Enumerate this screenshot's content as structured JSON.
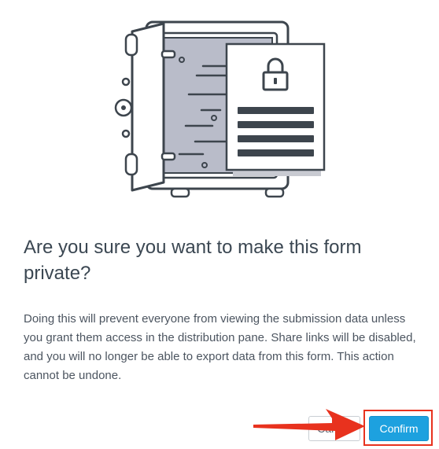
{
  "dialog": {
    "title": "Are you sure you want to make this form private?",
    "message": "Doing this will prevent everyone from viewing the submission data unless you grant them access in the distribution pane. Share links will be disabled, and you will no longer be able to export data from this form. This action cannot be undone.",
    "cancel_label": "Cancel",
    "confirm_label": "Confirm"
  },
  "illustration": {
    "name": "vault-with-locked-document",
    "icon": "lock-icon"
  },
  "annotations": {
    "arrow": "red-pointer-arrow",
    "highlight": "red-highlight-box"
  },
  "colors": {
    "title": "#3b4752",
    "body": "#4c5560",
    "confirm_bg": "#1da1df",
    "annotation_red": "#e8321e",
    "outline": "#3d454d",
    "vault_interior": "#b9bcc9"
  }
}
